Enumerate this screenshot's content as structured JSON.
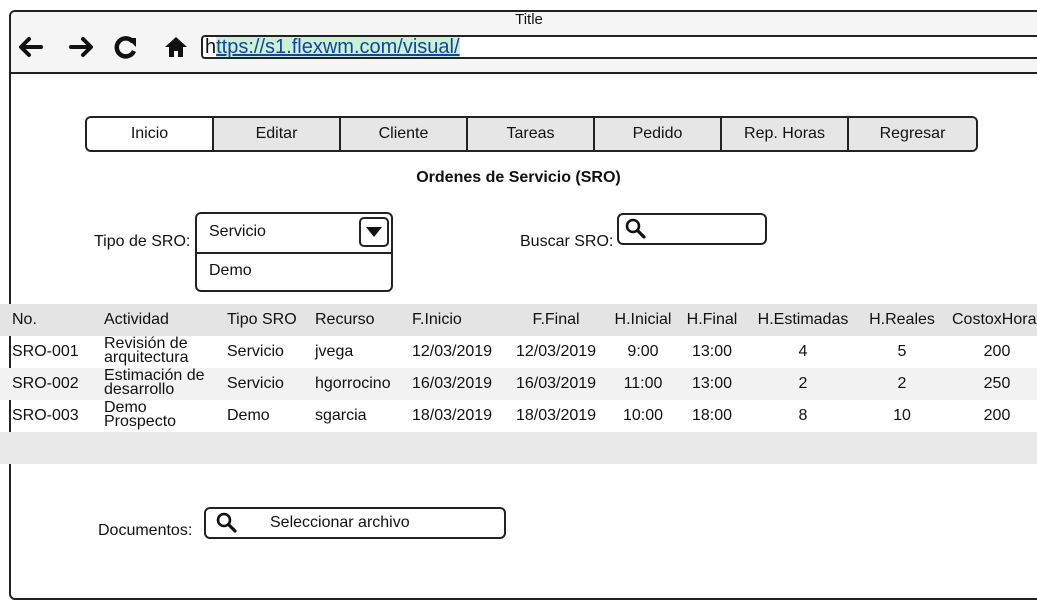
{
  "browser": {
    "title": "Title",
    "url_prefix": "h",
    "url_link": "ttps://s1.flexwm.com/visual/"
  },
  "tabs": [
    "Inicio",
    "Editar",
    "Cliente",
    "Tareas",
    "Pedido",
    "Rep. Horas",
    "Regresar"
  ],
  "heading": "Ordenes de Servicio (SRO)",
  "filter": {
    "label": "Tipo de SRO:",
    "selected": "Servicio",
    "options_visible": [
      "Demo"
    ]
  },
  "search": {
    "label": "Buscar SRO:"
  },
  "table": {
    "columns": [
      "No.",
      "Actividad",
      "Tipo SRO",
      "Recurso",
      "F.Inicio",
      "F.Final",
      "H.Inicial",
      "H.Final",
      "H.Estimadas",
      "H.Reales",
      "CostoxHora"
    ],
    "rows": [
      [
        "SRO-001",
        "Revisión de arquitectura",
        "Servicio",
        "jvega",
        "12/03/2019",
        "12/03/2019",
        "9:00",
        "13:00",
        "4",
        "5",
        "200"
      ],
      [
        "SRO-002",
        "Estimación de desarrollo",
        "Servicio",
        "hgorrocino",
        "16/03/2019",
        "16/03/2019",
        "11:00",
        "13:00",
        "2",
        "2",
        "250"
      ],
      [
        "SRO-003",
        "Demo Prospecto",
        "Demo",
        "sgarcia",
        "18/03/2019",
        "18/03/2019",
        "10:00",
        "18:00",
        "8",
        "10",
        "200"
      ]
    ]
  },
  "documents": {
    "label": "Documentos:",
    "button": "Seleccionar archivo"
  }
}
